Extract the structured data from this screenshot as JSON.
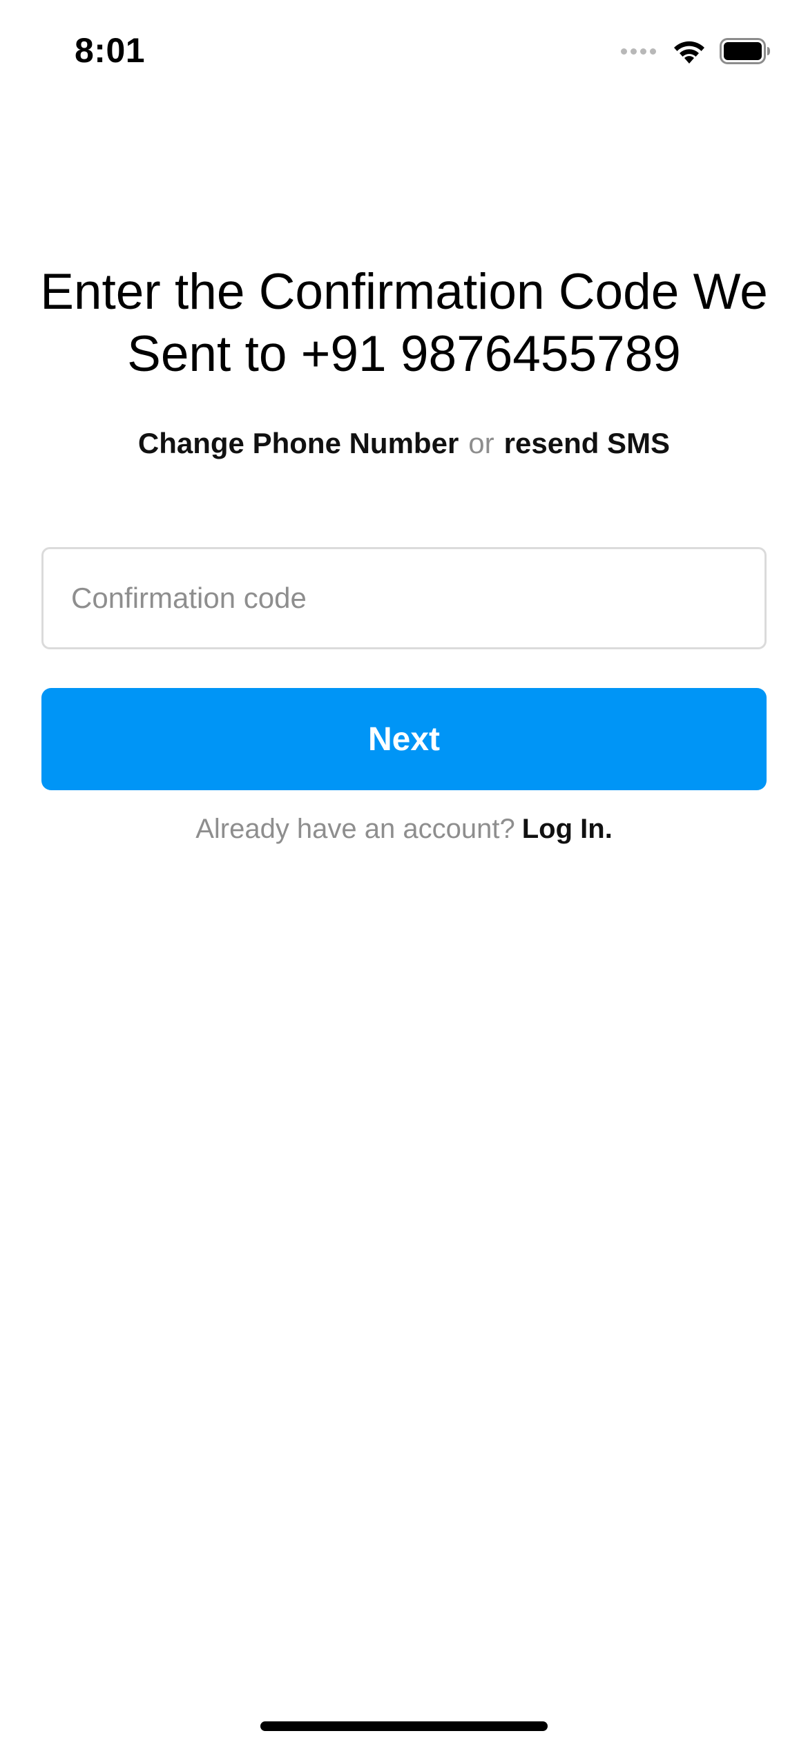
{
  "status_bar": {
    "time": "8:01",
    "icons": [
      "cellular-signal-icon",
      "wifi-icon",
      "battery-icon"
    ]
  },
  "heading": {
    "title": "Enter the Confirmation Code We Sent to +91 9876455789"
  },
  "links": {
    "change_phone": "Change Phone Number",
    "separator": "or",
    "resend_sms": "resend SMS"
  },
  "form": {
    "code_input": {
      "value": "",
      "placeholder": "Confirmation code"
    },
    "next_label": "Next"
  },
  "footer": {
    "prompt": "Already have an account?",
    "login_label": "Log In."
  },
  "colors": {
    "primary": "#0095f6",
    "muted_text": "#8e8e8e",
    "input_border": "#dbdbdb",
    "background": "#ffffff"
  }
}
